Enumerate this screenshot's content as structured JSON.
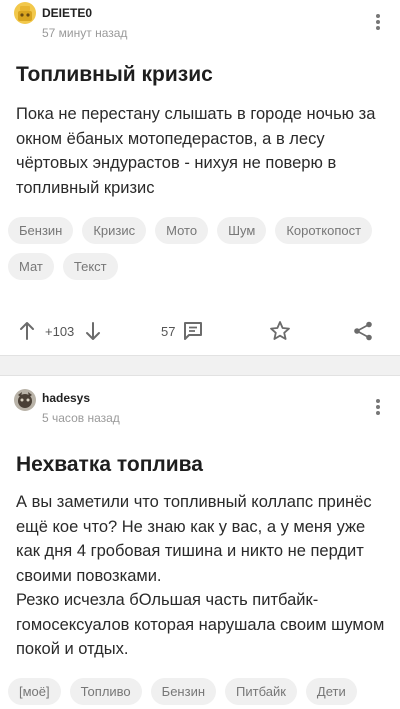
{
  "posts": [
    {
      "author": "DEIETE0",
      "time": "57 минут назад",
      "title": "Топливный кризис",
      "body": "Пока не перестану слышать в городе ночью за окном ёбаных мотопедерастов, а в лесу чёртовых эндурастов - нихуя не поверю в топливный кризис",
      "tags": [
        "Бензин",
        "Кризис",
        "Мото",
        "Шум",
        "Короткопост",
        "Мат",
        "Текст"
      ],
      "rating": "+103",
      "comments": "57"
    },
    {
      "author": "hadesys",
      "time": "5 часов назад",
      "title": "Нехватка топлива",
      "body_lines": [
        "А вы заметили что топливный коллапс принёс ещё кое что? Не знаю как у вас, а у меня уже как дня 4 гробовая тишина и никто не пердит своими повозками.",
        "Резко исчезла бОльшая часть питбайк-гомосексуалов которая нарушала своим шумом покой и отдых."
      ],
      "tags": [
        "[моё]",
        "Топливо",
        "Бензин",
        "Питбайк",
        "Дети"
      ]
    }
  ],
  "colors": {
    "accent": "#8ac858",
    "icon": "#6b6b6b",
    "tag_bg": "#f0f0f0"
  },
  "icons": [
    "upvote-arrow-icon",
    "downvote-arrow-icon",
    "comment-icon",
    "star-icon",
    "share-icon",
    "more-vertical-icon"
  ]
}
